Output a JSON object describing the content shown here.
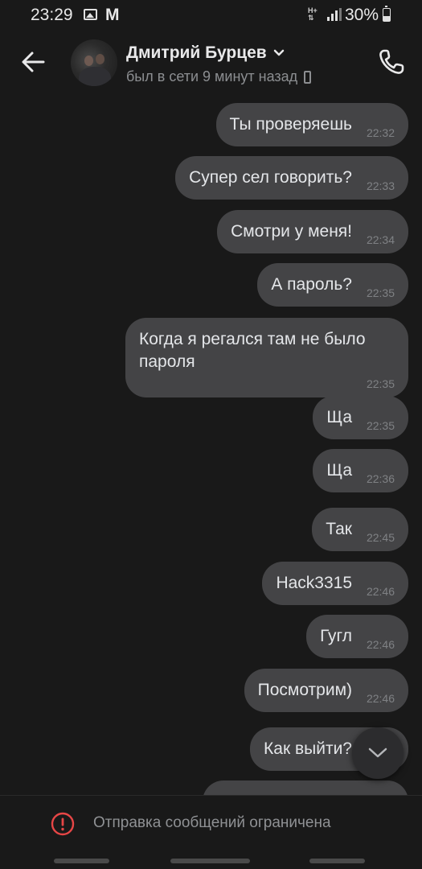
{
  "status_bar": {
    "time": "23:29",
    "mail_letter": "M",
    "network_label": "H+",
    "battery": "30%"
  },
  "header": {
    "contact_name": "Дмитрий Бурцев",
    "last_seen": "был в сети 9 минут назад"
  },
  "messages": [
    {
      "text": "Ты проверяешь",
      "time": "22:32"
    },
    {
      "text": "Супер сел говорить?",
      "time": "22:33"
    },
    {
      "text": "Смотри у меня!",
      "time": "22:34"
    },
    {
      "text": "А пароль?",
      "time": "22:35"
    },
    {
      "text": "Когда я регался там не было пароля",
      "time": "22:35"
    },
    {
      "text": "Ща",
      "time": "22:35"
    },
    {
      "text": "Ща",
      "time": "22:36"
    },
    {
      "text": "Так",
      "time": "22:45"
    },
    {
      "text": "Hack3315",
      "time": "22:46"
    },
    {
      "text": "Гугл",
      "time": "22:46"
    },
    {
      "text": "Посмотрим)",
      "time": "22:46"
    },
    {
      "text": "Как выйти?",
      "time": ""
    }
  ],
  "footer": {
    "notice": "Отправка сообщений ограничена"
  },
  "colors": {
    "background": "#191919",
    "bubble": "#444446",
    "warning": "#e64646"
  }
}
